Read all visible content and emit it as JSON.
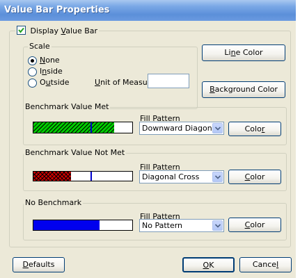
{
  "window": {
    "title": "Value Bar Properties"
  },
  "display_value_bar": {
    "checked": true,
    "label_pre": "Display ",
    "label_key": "V",
    "label_post": "alue Bar"
  },
  "scale": {
    "legend": "Scale",
    "options": [
      {
        "pre": "",
        "key": "N",
        "post": "one",
        "selected": true
      },
      {
        "pre": "I",
        "key": "n",
        "post": "side",
        "selected": false
      },
      {
        "pre": "O",
        "key": "u",
        "post": "tside",
        "selected": false
      }
    ],
    "unit_label_pre": "",
    "unit_label_key": "U",
    "unit_label_post": "nit of Measure:",
    "unit_value": ""
  },
  "buttons": {
    "line_color": {
      "pre": "Li",
      "key": "n",
      "post": "e Color"
    },
    "background_color": {
      "pre": "",
      "key": "B",
      "post": "ackground Color"
    },
    "defaults": {
      "pre": "",
      "key": "D",
      "post": "efaults"
    },
    "ok": {
      "pre": "",
      "key": "O",
      "post": "K"
    },
    "cancel": {
      "pre": "Cance",
      "key": "l",
      "post": ""
    }
  },
  "benchmarks": [
    {
      "legend": "Benchmark Value Met",
      "fill_pattern_pre": "",
      "fill_pattern_key": "F",
      "fill_pattern_post": "ill Pattern",
      "pattern": "Downward Diagonal",
      "color_pre": "Colo",
      "color_key": "r",
      "color_post": "",
      "fill_color": "#00cc00",
      "pattern_type": "diagonal",
      "fill_fraction": 0.82,
      "benchmark_fraction": 0.58
    },
    {
      "legend": "Benchmark Value Not Met",
      "fill_pattern_pre": "Fill ",
      "fill_pattern_key": "P",
      "fill_pattern_post": "attern",
      "pattern": "Diagonal Cross",
      "color_pre": "",
      "color_key": "C",
      "color_post": "olor",
      "fill_color": "#cc0000",
      "pattern_type": "crosshatch",
      "fill_fraction": 0.38,
      "benchmark_fraction": 0.58
    },
    {
      "legend": "No Benchmark",
      "fill_pattern_pre": "Fill ",
      "fill_pattern_key": "P",
      "fill_pattern_post": "attern",
      "pattern": "No Pattern",
      "color_pre": "",
      "color_key": "C",
      "color_post": "olor",
      "fill_color": "#0000ee",
      "pattern_type": "solid",
      "fill_fraction": 0.67,
      "benchmark_fraction": null
    }
  ]
}
